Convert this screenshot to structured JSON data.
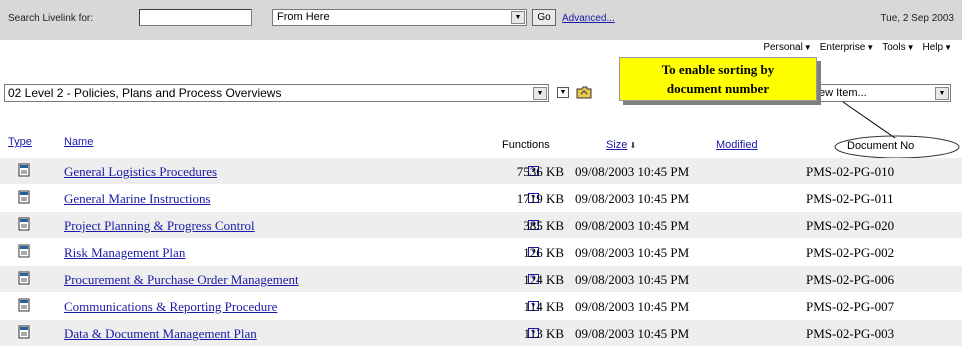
{
  "search": {
    "label": "Search Livelink for:",
    "query_value": "",
    "scope_value": "From Here",
    "go_label": "Go",
    "advanced_label": "Advanced..."
  },
  "date": "Tue, 2 Sep 2003",
  "menus": [
    "Personal",
    "Enterprise",
    "Tools",
    "Help"
  ],
  "location": {
    "value": "02 Level 2 - Policies, Plans and Process Overviews"
  },
  "add_item": {
    "value_visible": "ew Item..."
  },
  "callout": {
    "line1": "To enable sorting by",
    "line2": "document number"
  },
  "columns": {
    "type": "Type",
    "name": "Name",
    "functions": "Functions",
    "size": "Size",
    "modified": "Modified",
    "document_no": "Document No"
  },
  "rows": [
    {
      "name": "General Logistics Procedures",
      "size": "7536 KB",
      "modified": "09/08/2003 10:45 PM",
      "doc_no": "PMS-02-PG-010"
    },
    {
      "name": "General Marine Instructions",
      "size": "1719 KB",
      "modified": "09/08/2003 10:45 PM",
      "doc_no": "PMS-02-PG-011"
    },
    {
      "name": "Project Planning & Progress Control",
      "size": "385 KB",
      "modified": "09/08/2003 10:45 PM",
      "doc_no": "PMS-02-PG-020"
    },
    {
      "name": "Risk Management Plan",
      "size": "126 KB",
      "modified": "09/08/2003 10:45 PM",
      "doc_no": "PMS-02-PG-002"
    },
    {
      "name": "Procurement & Purchase Order Management",
      "size": "124 KB",
      "modified": "09/08/2003 10:45 PM",
      "doc_no": "PMS-02-PG-006"
    },
    {
      "name": "Communications & Reporting Procedure",
      "size": "114 KB",
      "modified": "09/08/2003 10:45 PM",
      "doc_no": "PMS-02-PG-007"
    },
    {
      "name": "Data & Document Management Plan",
      "size": "113 KB",
      "modified": "09/08/2003 10:45 PM",
      "doc_no": "PMS-02-PG-003"
    }
  ],
  "colors": {
    "link": "#1a1aa6",
    "callout_bg": "#ffff00",
    "searchbar_bg": "#d8d8d8",
    "row_alt_bg": "#eeeeee"
  }
}
